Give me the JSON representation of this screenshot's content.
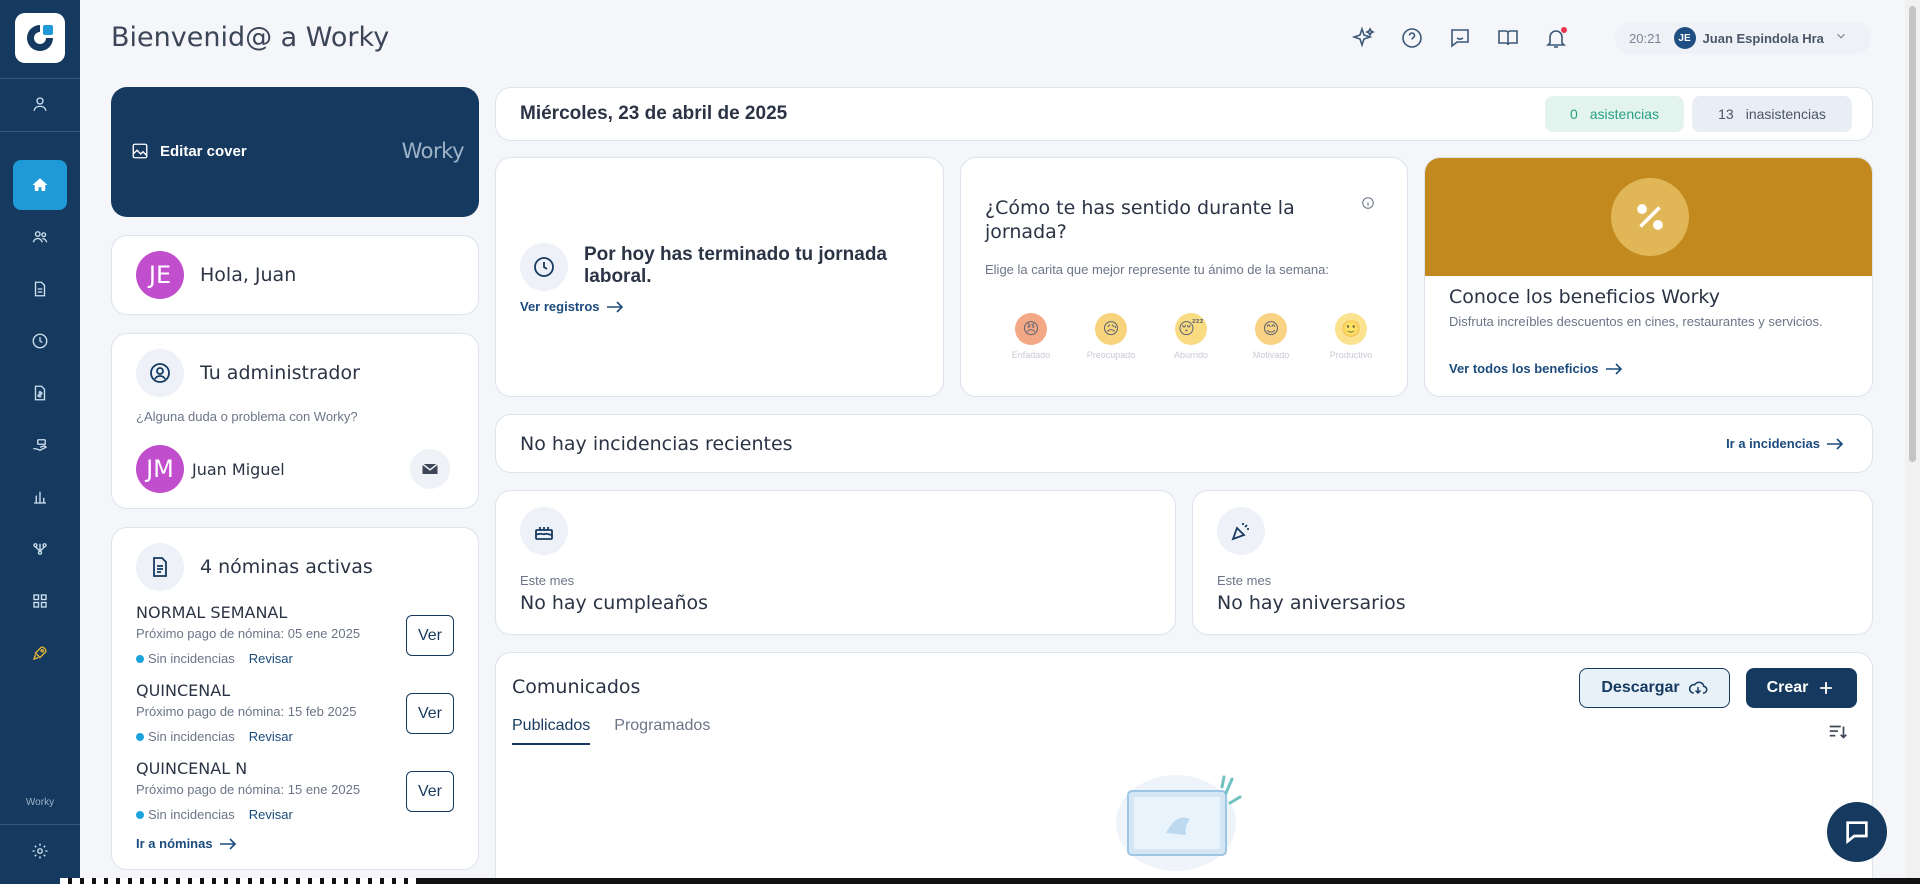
{
  "colors": {
    "navy": "#163a5f",
    "accent": "#1f9ad6",
    "avatar": "#c14ecd",
    "gold": "#c28a1e"
  },
  "sidebar": {
    "icons": [
      "user-icon",
      "home-icon",
      "team-icon",
      "document-icon",
      "clock-icon",
      "payroll-icon",
      "hand-money-icon",
      "bar-chart-icon",
      "org-icon",
      "apps-grid-icon",
      "rocket-icon",
      "settings-icon"
    ],
    "footer_brand": "Worky"
  },
  "header": {
    "title": "Bienvenid@ a Worky",
    "time": "20:21",
    "user_initials": "JE",
    "user_name": "Juan Espindola Hra"
  },
  "cover": {
    "edit_label": "Editar cover",
    "brand": "Worky"
  },
  "greeting": {
    "initials": "JE",
    "text": "Hola, Juan"
  },
  "admin": {
    "title": "Tu administrador",
    "question": "¿Alguna duda o problema con Worky?",
    "initials": "JM",
    "name": "Juan Miguel"
  },
  "payrolls": {
    "title": "4 nóminas activas",
    "items": [
      {
        "name": "NORMAL SEMANAL",
        "next": "Próximo pago de nómina: 05 ene 2025",
        "status": "Sin incidencias",
        "review": "Revisar",
        "button": "Ver"
      },
      {
        "name": "QUINCENAL",
        "next": "Próximo pago de nómina: 15 feb 2025",
        "status": "Sin incidencias",
        "review": "Revisar",
        "button": "Ver"
      },
      {
        "name": "QUINCENAL N",
        "next": "Próximo pago de nómina: 15 ene 2025",
        "status": "Sin incidencias",
        "review": "Revisar",
        "button": "Ver"
      }
    ],
    "link": "Ir a nóminas"
  },
  "date_bar": {
    "date": "Miércoles, 23 de abril de 2025",
    "attend_count": "0",
    "attend_label": "asistencias",
    "absent_count": "13",
    "absent_label": "inasistencias"
  },
  "workday": {
    "text": "Por hoy has terminado tu jornada laboral.",
    "link": "Ver registros"
  },
  "mood": {
    "title": "¿Cómo te has sentido durante la jornada?",
    "subtitle": "Elige la carita que mejor represente tu ánimo de la semana:",
    "options": [
      "Enfadado",
      "Preocupado",
      "Aburrido",
      "Motivado",
      "Productivo"
    ]
  },
  "benefits": {
    "title": "Conoce los beneficios Worky",
    "desc": "Disfruta increíbles descuentos en cines, restaurantes y servicios.",
    "link": "Ver todos los beneficios"
  },
  "incidents": {
    "text": "No hay incidencias recientes",
    "link": "Ir a incidencias"
  },
  "birthdays": {
    "period": "Este mes",
    "text": "No hay cumpleaños"
  },
  "anniversaries": {
    "period": "Este mes",
    "text": "No hay aniversarios"
  },
  "announcements": {
    "title": "Comunicados",
    "download": "Descargar",
    "create": "Crear",
    "tabs": [
      "Publicados",
      "Programados"
    ]
  }
}
